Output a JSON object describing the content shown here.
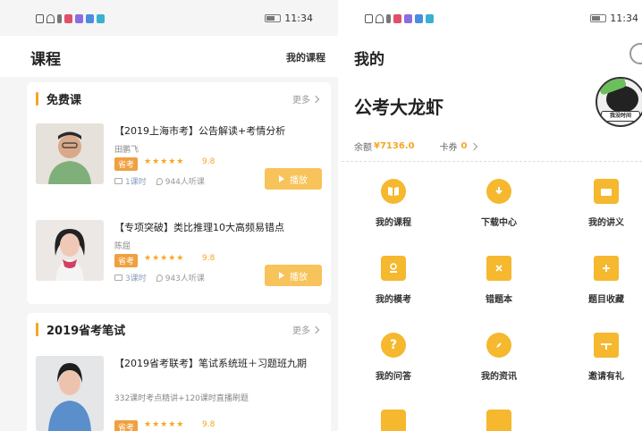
{
  "left": {
    "status_time": "",
    "title": "课程",
    "my_courses_link": "我的课程",
    "free_section": {
      "title": "免费课",
      "more": "更多",
      "courses": [
        {
          "title": "【2019上海市考】公告解读+考情分析",
          "teacher": "田鹏飞",
          "tag": "省考",
          "stars": "★★★★★",
          "score": "9.8",
          "lessons": "1课时",
          "listeners": "944人听课",
          "play": "播放"
        },
        {
          "title": "【专项突破】类比推理10大高频易错点",
          "teacher": "陈屈",
          "tag": "省考",
          "stars": "★★★★★",
          "score": "9.8",
          "lessons": "3课时",
          "listeners": "943人听课",
          "play": "播放"
        }
      ]
    },
    "exam_section": {
      "title": "2019省考笔试",
      "more": "更多",
      "course": {
        "title": "【2019省考联考】笔试系统班＋习题班九期",
        "subtitle": "332课时考点精讲+120课时直播刷题",
        "tag": "省考",
        "stars": "★★★★★",
        "score": "9.8"
      }
    }
  },
  "right": {
    "status_time": "11:34",
    "title": "我的",
    "username": "公考大龙虾",
    "avatar_caption": "我没时间",
    "balance_label": "余额",
    "balance_value": "¥7136.0",
    "coupon_label": "卡券",
    "coupon_value": "0",
    "grid": [
      {
        "label": "我的课程",
        "icon": "book-icon"
      },
      {
        "label": "下载中心",
        "icon": "download-icon"
      },
      {
        "label": "我的讲义",
        "icon": "folder-icon"
      },
      {
        "label": "我的模考",
        "icon": "exam-icon"
      },
      {
        "label": "错题本",
        "icon": "wrong-book-icon"
      },
      {
        "label": "题目收藏",
        "icon": "bookmark-icon"
      },
      {
        "label": "我的问答",
        "icon": "question-icon"
      },
      {
        "label": "我的资讯",
        "icon": "compass-icon"
      },
      {
        "label": "邀请有礼",
        "icon": "gift-icon"
      }
    ]
  },
  "left_status_time": "11:34",
  "colors": {
    "accent": "#f5a623",
    "play_button": "#f7c35a",
    "tag": "#f0a040",
    "icon_yellow": "#f5b82e"
  }
}
